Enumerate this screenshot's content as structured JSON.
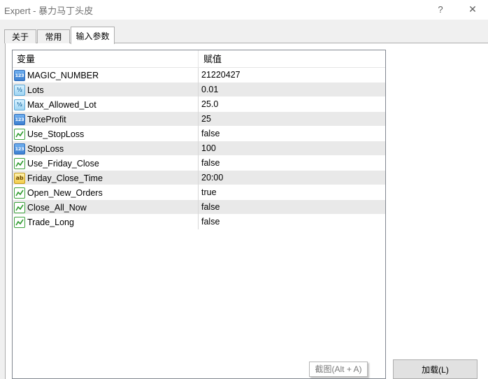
{
  "window": {
    "title": "Expert - 暴力马丁头皮",
    "help_glyph": "?",
    "close_glyph": "✕"
  },
  "tabs": [
    {
      "label": "关于",
      "active": false
    },
    {
      "label": "常用",
      "active": false
    },
    {
      "label": "输入参数",
      "active": true
    }
  ],
  "grid": {
    "columns": [
      "变量",
      "赋值"
    ],
    "rows": [
      {
        "name": "MAGIC_NUMBER",
        "value": "21220427",
        "type": "int-icon",
        "glyph": "123"
      },
      {
        "name": "Lots",
        "value": "0.01",
        "type": "double-icon",
        "glyph": "½"
      },
      {
        "name": "Max_Allowed_Lot",
        "value": "25.0",
        "type": "double-icon",
        "glyph": "½"
      },
      {
        "name": "TakeProfit",
        "value": "25",
        "type": "int-icon",
        "glyph": "123"
      },
      {
        "name": "Use_StopLoss",
        "value": "false",
        "type": "bool-icon",
        "glyph": ""
      },
      {
        "name": "StopLoss",
        "value": "100",
        "type": "int-icon",
        "glyph": "123"
      },
      {
        "name": "Use_Friday_Close",
        "value": "false",
        "type": "bool-icon",
        "glyph": ""
      },
      {
        "name": "Friday_Close_Time",
        "value": "20:00",
        "type": "string-icon",
        "glyph": "ab"
      },
      {
        "name": "Open_New_Orders",
        "value": "true",
        "type": "bool-icon",
        "glyph": ""
      },
      {
        "name": "Close_All_Now",
        "value": "false",
        "type": "bool-icon",
        "glyph": ""
      },
      {
        "name": "Trade_Long",
        "value": "false",
        "type": "bool-icon",
        "glyph": ""
      }
    ]
  },
  "tooltip": {
    "text": "截图(Alt + A)"
  },
  "buttons": {
    "load_label": "加载(L)"
  },
  "colors": {
    "alt_row": "#e9e9e9",
    "bool_icon_stroke": "#2e9a2e",
    "int_icon_fill": "#3d7fd0",
    "string_icon_fill": "#f2cc4a"
  }
}
